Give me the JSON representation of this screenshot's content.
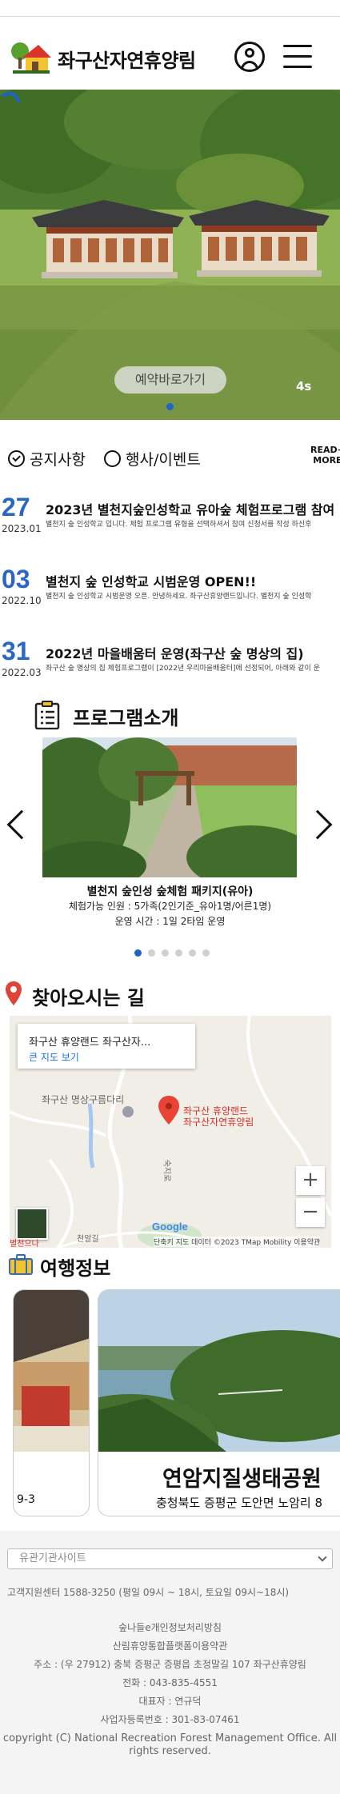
{
  "header": {
    "title": "좌구산자연휴양림",
    "logo_icon": "house-tree-logo",
    "user_icon": "user-icon",
    "menu_icon": "hamburger-menu-icon"
  },
  "hero": {
    "reserve_label": "예약바로가기",
    "timer": "4s",
    "accent": "#1f63c8"
  },
  "notice": {
    "tabs": [
      {
        "label": "공지사항",
        "selected": true
      },
      {
        "label": "행사/이벤트",
        "selected": false
      }
    ],
    "readmore_line1": "READ+",
    "readmore_line2": "MORE",
    "items": [
      {
        "day": "27",
        "ym": "2023.01",
        "title": "2023년 별천지숲인성학교 유아숲 체험프로그램 참여",
        "desc": "별천지 숲 인성학교 입니다. 체험 프로그램 유형을 선택하셔서 참여 신청서를 작성 하신후"
      },
      {
        "day": "03",
        "ym": "2022.10",
        "title": "별천지 숲 인성학교 시범운영 OPEN!!",
        "desc": "별천지 숲 인성학교 시범운영 오픈. 안녕하세요. 좌구산휴양랜드입니다. 별천지 숲 인성학"
      },
      {
        "day": "31",
        "ym": "2022.03",
        "title": "2022년 마을배움터 운영(좌구산 숲 명상의 집)",
        "desc": "좌구산 숲 명상의 집 체험프로그램이 [2022년 우리마을배움터]에 선정되어, 아래와 같이 운"
      }
    ]
  },
  "program": {
    "title": "프로그램소개",
    "caption_title": "별천지 숲인성 숲체험 패키지(유아)",
    "caption_people": "체험가능 인원 : 5가족(2인기준_유아1명/어른1명)",
    "caption_time": "운영 시간 : 1일 2타임 운영",
    "dot_count": 6,
    "active_dot": 0
  },
  "directions": {
    "title": "찾아오시는 길",
    "map_place": "좌구산 휴양랜드 좌구산자...",
    "map_link": "큰 지도 보기",
    "map_label_bridge": "좌구산 명상구름다리",
    "map_marker_line1": "좌구산 휴양랜드",
    "map_marker_line2": "좌구산자연휴양림",
    "road_label": "숙지로",
    "zoom_in": "+",
    "zoom_out": "−",
    "google": "Google",
    "attribution": "단축키   지도 데이터 ©2023 TMap Mobility   이용약관",
    "corner_label_1": "별천으나",
    "corner_label_2": "천알길"
  },
  "travel": {
    "title": "여행정보",
    "left_card_text": "9-3",
    "card_title": "연암지질생태공원",
    "card_addr": "충청북도 증평군 도안면 노암리 8"
  },
  "footer": {
    "select_placeholder": "유관기관사이트",
    "customer_center": "고객지원센터 1588-3250 (평일 09시 ~ 18시, 토요일 09시~18시)",
    "line1": "숲나들e개인정보처리방침",
    "line2": "산림휴양통합플랫폼이용약관",
    "address": "주소 : (우 27912) 충북 증평군 증평읍 초정말길 107 좌구산휴양림",
    "phone": "전화 : 043-835-4551",
    "ceo": "대표자 : 연규덕",
    "bizno": "사업자등록번호 : 301-83-07461",
    "copyright_1": "copyright (C) National Recreation Forest Management Office. All",
    "copyright_2": "rights reserved."
  }
}
